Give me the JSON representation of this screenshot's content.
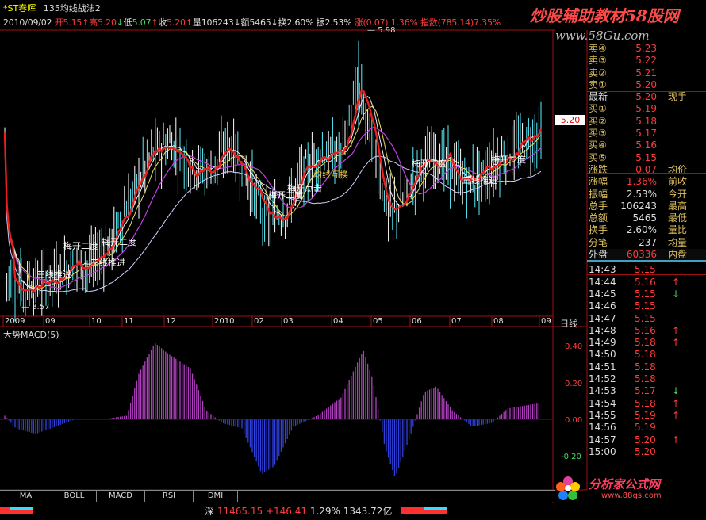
{
  "header": {
    "code": "*ST春晖",
    "formula": "135均线战法2",
    "date": "2010/09/02",
    "open_label": "开",
    "open_value": "5.15",
    "high_label": "高",
    "high_value": "5.20",
    "low_label": "低",
    "low_value": "5.07",
    "close_label": "收",
    "close_value": "5.20",
    "volume_label": "量",
    "volume_value": "106243",
    "amount_label": "额",
    "amount_value": "5465",
    "turnover_label": "换",
    "turnover_value": "2.60%",
    "amplitude_label": "振",
    "amplitude_value": "2.53%",
    "change_label": "涨",
    "change_value": "(0.07)",
    "change_pct": "1.36%",
    "index_label": "指数",
    "index_value": "(785.14)",
    "index_pct": "7.35%"
  },
  "watermark": {
    "line1": "炒股辅助教材58股网",
    "line2": "www.58Gu.com",
    "logo": "分析家公式网",
    "logo_url_text": "www.88gs.com"
  },
  "price_chart": {
    "high_mark": "5.98",
    "low_mark": "3.57",
    "current_tag": "5.20",
    "annotations": [
      "三线推进",
      "梅开二度",
      "梅开二度",
      "三线推进",
      "梅开点击",
      "均线互换",
      "梅开二度",
      "梅开二度",
      "三线推进",
      "梅开二度"
    ],
    "x_axis": [
      "2009",
      "09",
      "10",
      "11",
      "12",
      "2010",
      "02",
      "03",
      "04",
      "05",
      "06",
      "07",
      "08",
      "09"
    ],
    "period_label": "日线"
  },
  "macd_chart": {
    "title": "大势MACD(5)",
    "y_ticks": [
      "0.40",
      "0.20",
      "0.00",
      "-0.20"
    ]
  },
  "quote_panel": {
    "asks": [
      {
        "label": "卖④",
        "value": "5.23"
      },
      {
        "label": "卖③",
        "value": "5.22"
      },
      {
        "label": "卖②",
        "value": "5.21"
      },
      {
        "label": "卖①",
        "value": "5.20"
      }
    ],
    "latest": {
      "label": "最新",
      "value": "5.20",
      "extra": "现手"
    },
    "bids": [
      {
        "label": "买①",
        "value": "5.19"
      },
      {
        "label": "买②",
        "value": "5.18"
      },
      {
        "label": "买③",
        "value": "5.17"
      },
      {
        "label": "买④",
        "value": "5.16"
      },
      {
        "label": "买⑤",
        "value": "5.15"
      }
    ],
    "stats": [
      {
        "label": "涨跌",
        "value": "0.07",
        "label2": "均价"
      },
      {
        "label": "涨幅",
        "value": "1.36%",
        "label2": "前收"
      },
      {
        "label": "振幅",
        "value": "2.53%",
        "label2": "今开"
      },
      {
        "label": "总手",
        "value": "106243",
        "label2": "最高"
      },
      {
        "label": "总额",
        "value": "5465",
        "label2": "最低"
      },
      {
        "label": "换手",
        "value": "2.60%",
        "label2": "量比"
      },
      {
        "label": "分笔",
        "value": "237",
        "label2": "均量"
      }
    ],
    "outer": {
      "label": "外盘",
      "value": "60336",
      "label2": "内盘"
    },
    "ticks": [
      {
        "time": "14:43",
        "price": "5.15",
        "arrow": ""
      },
      {
        "time": "14:44",
        "price": "5.16",
        "arrow": "↑"
      },
      {
        "time": "14:45",
        "price": "5.15",
        "arrow": "↓"
      },
      {
        "time": "14:46",
        "price": "5.15",
        "arrow": ""
      },
      {
        "time": "14:47",
        "price": "5.15",
        "arrow": ""
      },
      {
        "time": "14:48",
        "price": "5.16",
        "arrow": "↑"
      },
      {
        "time": "14:49",
        "price": "5.18",
        "arrow": "↑"
      },
      {
        "time": "14:50",
        "price": "5.18",
        "arrow": ""
      },
      {
        "time": "14:51",
        "price": "5.18",
        "arrow": ""
      },
      {
        "time": "14:52",
        "price": "5.18",
        "arrow": ""
      },
      {
        "time": "14:53",
        "price": "5.17",
        "arrow": "↓"
      },
      {
        "time": "14:54",
        "price": "5.18",
        "arrow": "↑"
      },
      {
        "time": "14:55",
        "price": "5.19",
        "arrow": "↑"
      },
      {
        "time": "14:56",
        "price": "5.19",
        "arrow": ""
      },
      {
        "time": "14:57",
        "price": "5.20",
        "arrow": "↑"
      },
      {
        "time": "15:00",
        "price": "5.20",
        "arrow": ""
      }
    ]
  },
  "tabs": [
    "MA",
    "BOLL",
    "MACD",
    "RSI",
    "DMI"
  ],
  "status_bar": {
    "market": "深",
    "index": "11465.15",
    "change": "+146.41",
    "pct": "1.29%",
    "amount": "1343.72亿"
  },
  "colors": {
    "up": "#ff3c3c",
    "down": "#4cd96a",
    "ma_red": "#e82020",
    "ma_white": "#f0f0f0",
    "ma_yellow": "#e8e060",
    "ma_purple": "#c040e0",
    "ma_light": "#d0d0ff",
    "macd_pos": "#b040c0",
    "macd_neg": "#3040e0"
  }
}
